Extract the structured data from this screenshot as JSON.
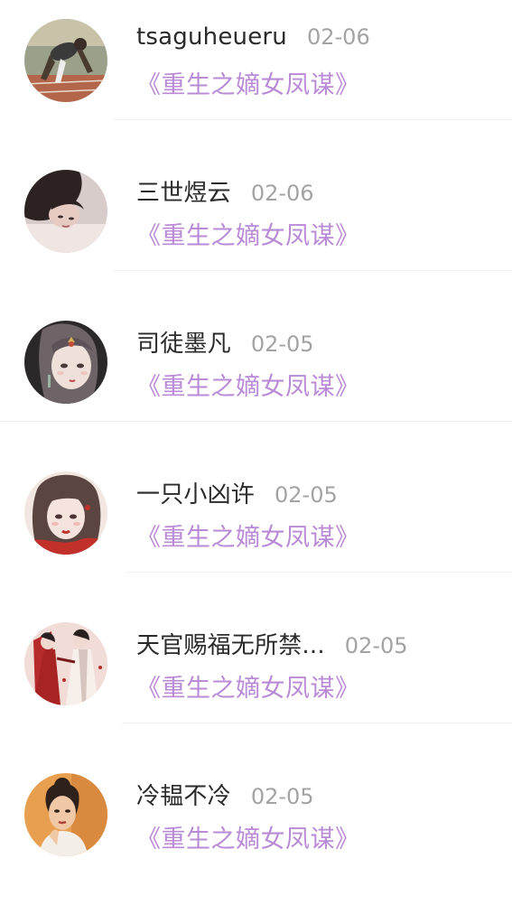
{
  "comments": [
    {
      "user": "tsaguheueru",
      "time": "02-06",
      "book": "《重生之嫡女凤谋》",
      "avatar": {
        "icon": "avatar-runner-photo",
        "bg": "#8a9078",
        "fg": "#4a3b30",
        "accent": "#b05a3a"
      }
    },
    {
      "user": "三世煜云",
      "time": "02-06",
      "book": "《重生之嫡女凤谋》",
      "avatar": {
        "icon": "avatar-woman-portrait",
        "bg": "#d6c8c6",
        "fg": "#3a2a2a",
        "accent": "#e8d8d4"
      }
    },
    {
      "user": "司徒墨凡",
      "time": "02-05",
      "book": "《重生之嫡女凤谋》",
      "avatar": {
        "icon": "avatar-illustrated-girl",
        "bg": "#2e2a2c",
        "fg": "#e8d6d0",
        "accent": "#d9b25a"
      }
    },
    {
      "user": "一只小凶许",
      "time": "02-05",
      "book": "《重生之嫡女凤谋》",
      "avatar": {
        "icon": "avatar-illustrated-girl-red",
        "bg": "#f3e4dc",
        "fg": "#5a3a34",
        "accent": "#c2302a"
      }
    },
    {
      "user": "天官赐福无所禁...",
      "time": "02-05",
      "book": "《重生之嫡女凤谋》",
      "avatar": {
        "icon": "avatar-illustrated-couple",
        "bg": "#f0dcd8",
        "fg": "#3a2a2a",
        "accent": "#b52a2a"
      }
    },
    {
      "user": "冷韫不冷",
      "time": "02-05",
      "book": "《重生之嫡女凤谋》",
      "avatar": {
        "icon": "avatar-woman-orange",
        "bg": "#e59a4a",
        "fg": "#2e211c",
        "accent": "#f0c89a"
      }
    }
  ],
  "colors": {
    "name": "#2a2a2a",
    "time": "#a3a3a3",
    "book": "#b98ad6",
    "divider": "#f1f1f1"
  }
}
